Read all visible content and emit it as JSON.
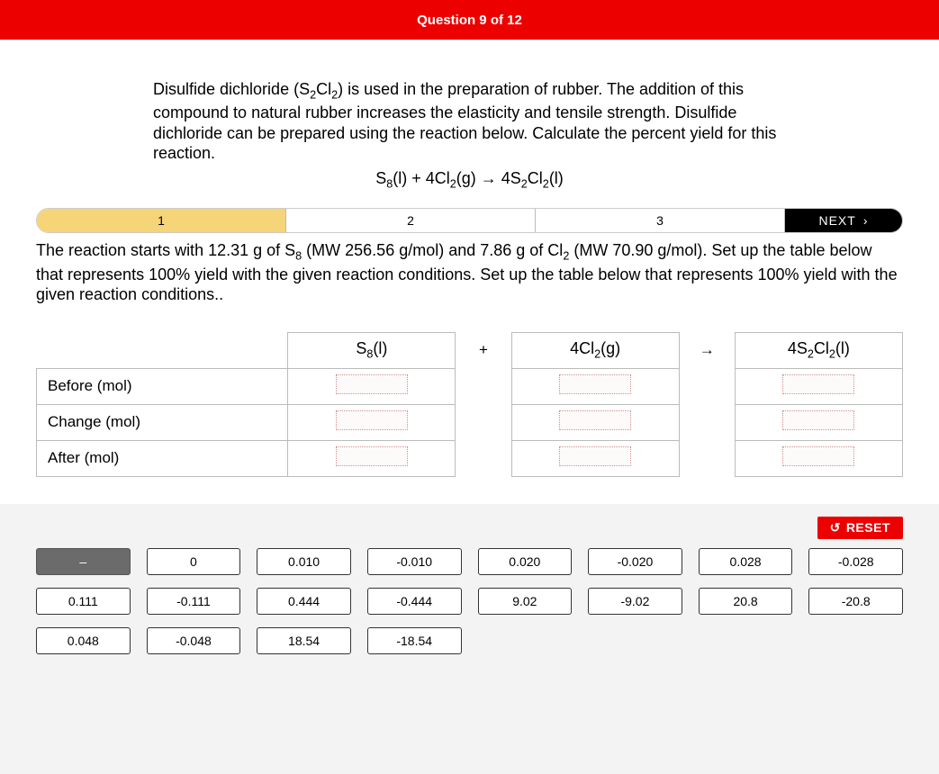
{
  "header": {
    "title": "Question 9 of 12"
  },
  "prompt": {
    "text_plain": "Disulfide dichloride (S₂Cl₂) is used in the preparation of rubber. The addition of this compound to natural rubber increases the elasticity and tensile strength. Disulfide dichloride can be prepared using the reaction below. Calculate the percent yield for this reaction.",
    "equation_plain": "S₈(l) + 4Cl₂(g) → 4S₂Cl₂(l)"
  },
  "steps": {
    "items": [
      "1",
      "2",
      "3"
    ],
    "active_index": 0,
    "next_label": "NEXT"
  },
  "sub_instruction": "The reaction starts with 12.31 g of S₈ (MW 256.56 g/mol) and 7.86 g of Cl₂ (MW 70.90 g/mol). Set up the table below that represents 100% yield with the given reaction conditions. Set up the table below that represents 100% yield with the given reaction conditions..",
  "table": {
    "row_labels": [
      "Before (mol)",
      "Change (mol)",
      "After (mol)"
    ],
    "col_species_plain": [
      "S₈(l)",
      "4Cl₂(g)",
      "4S₂Cl₂(l)"
    ],
    "operators": [
      "+",
      "→"
    ]
  },
  "answers": {
    "reset_label": "RESET",
    "chips": [
      {
        "label": "–",
        "dark": true
      },
      {
        "label": "0"
      },
      {
        "label": "0.010"
      },
      {
        "label": "-0.010"
      },
      {
        "label": "0.020"
      },
      {
        "label": "-0.020"
      },
      {
        "label": "0.028"
      },
      {
        "label": "-0.028"
      },
      {
        "label": "0.111"
      },
      {
        "label": "-0.111"
      },
      {
        "label": "0.444"
      },
      {
        "label": "-0.444"
      },
      {
        "label": "9.02"
      },
      {
        "label": "-9.02"
      },
      {
        "label": "20.8"
      },
      {
        "label": "-20.8"
      },
      {
        "label": "0.048"
      },
      {
        "label": "-0.048"
      },
      {
        "label": "18.54"
      },
      {
        "label": "-18.54"
      }
    ]
  }
}
